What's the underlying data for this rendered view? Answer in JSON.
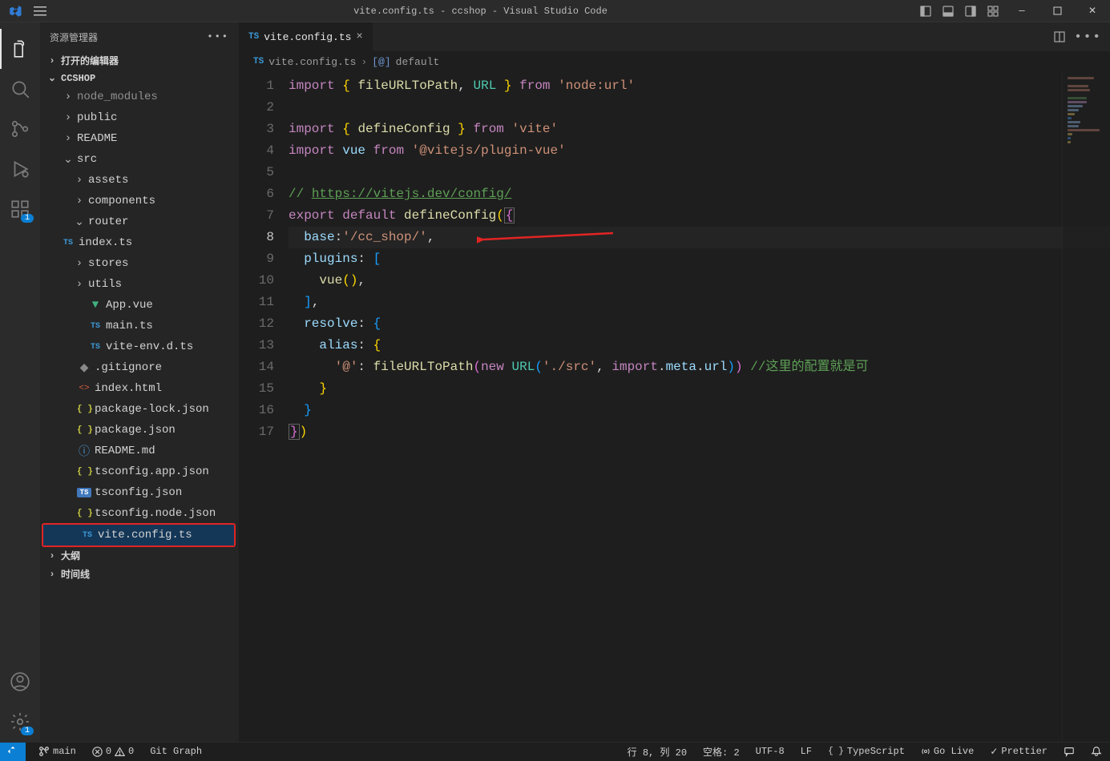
{
  "titlebar": {
    "title": "vite.config.ts - ccshop - Visual Studio Code"
  },
  "activitybar": {
    "ext_badge": "1",
    "settings_badge": "1"
  },
  "sidebar": {
    "header": "资源管理器",
    "sections": {
      "open_editors": "打开的编辑器",
      "project": "CCSHOP",
      "outline": "大纲",
      "timeline": "时间线"
    },
    "files": [
      {
        "name": "node_modules",
        "type": "folder",
        "depth": 1,
        "expanded": false,
        "dim": true
      },
      {
        "name": "public",
        "type": "folder",
        "depth": 1,
        "expanded": false
      },
      {
        "name": "README",
        "type": "folder",
        "depth": 1,
        "expanded": false
      },
      {
        "name": "src",
        "type": "folder",
        "depth": 1,
        "expanded": true
      },
      {
        "name": "assets",
        "type": "folder",
        "depth": 2,
        "expanded": false
      },
      {
        "name": "components",
        "type": "folder",
        "depth": 2,
        "expanded": false
      },
      {
        "name": "router",
        "type": "folder",
        "depth": 2,
        "expanded": true
      },
      {
        "name": "index.ts",
        "type": "ts",
        "depth": 3
      },
      {
        "name": "stores",
        "type": "folder",
        "depth": 2,
        "expanded": false
      },
      {
        "name": "utils",
        "type": "folder",
        "depth": 2,
        "expanded": false
      },
      {
        "name": "App.vue",
        "type": "vue",
        "depth": 2
      },
      {
        "name": "main.ts",
        "type": "ts",
        "depth": 2
      },
      {
        "name": "vite-env.d.ts",
        "type": "ts",
        "depth": 2
      },
      {
        "name": ".gitignore",
        "type": "git",
        "depth": 1
      },
      {
        "name": "index.html",
        "type": "html",
        "depth": 1
      },
      {
        "name": "package-lock.json",
        "type": "json",
        "depth": 1
      },
      {
        "name": "package.json",
        "type": "json",
        "depth": 1
      },
      {
        "name": "README.md",
        "type": "md",
        "depth": 1
      },
      {
        "name": "tsconfig.app.json",
        "type": "json",
        "depth": 1
      },
      {
        "name": "tsconfig.json",
        "type": "tsconfig",
        "depth": 1
      },
      {
        "name": "tsconfig.node.json",
        "type": "json",
        "depth": 1
      },
      {
        "name": "vite.config.ts",
        "type": "ts",
        "depth": 1,
        "selected": true,
        "highlighted": true
      }
    ]
  },
  "tab": {
    "file": "vite.config.ts"
  },
  "breadcrumb": {
    "file": "vite.config.ts",
    "symbol": "default"
  },
  "editor": {
    "lines": 17,
    "current_line": 8,
    "tokens": {
      "l1": {
        "kw1": "import",
        "pun1": "{",
        "fn": "fileURLToPath",
        "pun2": ",",
        "type": "URL",
        "pun3": "}",
        "kw2": "from",
        "str": "'node:url'"
      },
      "l3": {
        "kw1": "import",
        "pun1": "{",
        "fn": "defineConfig",
        "pun2": "}",
        "kw2": "from",
        "str": "'vite'"
      },
      "l4": {
        "kw1": "import",
        "var": "vue",
        "kw2": "from",
        "str": "'@vitejs/plugin-vue'"
      },
      "l6": {
        "cmt": "// ",
        "link": "https://vitejs.dev/config/"
      },
      "l7": {
        "kw1": "export",
        "kw2": "default",
        "fn": "defineConfig",
        "open": "(",
        "brace": "{"
      },
      "l8": {
        "prop": "base",
        "col": ":",
        "str": "'/cc_shop/'",
        "com": ","
      },
      "l9": {
        "prop": "plugins",
        "col": ":",
        "sp": " ",
        "br": "["
      },
      "l10": {
        "fn": "vue",
        "open": "(",
        "close": ")",
        "com": ","
      },
      "l11": {
        "br": "]",
        "com": ","
      },
      "l12": {
        "prop": "resolve",
        "col": ":",
        "sp": " ",
        "brace": "{"
      },
      "l13": {
        "prop": "alias",
        "col": ":",
        "sp": " ",
        "brace": "{"
      },
      "l14": {
        "str1": "'@'",
        "col": ":",
        "sp": " ",
        "fn": "fileURLToPath",
        "open": "(",
        "kw": "new",
        "sp2": " ",
        "type": "URL",
        "open2": "(",
        "str2": "'./src'",
        "com": ",",
        "sp3": " ",
        "kw2": "import",
        "dot": ".",
        "prop1": "meta",
        "dot2": ".",
        "prop2": "url",
        "close2": ")",
        "close": ")",
        "sp4": " ",
        "cmt": "//这里的配置就是可"
      },
      "l15": {
        "brace": "}"
      },
      "l16": {
        "brace": "}"
      },
      "l17": {
        "brace": "}",
        "close": ")"
      }
    }
  },
  "statusbar": {
    "branch": "main",
    "errors": "0",
    "warnings": "0",
    "gitgraph": "Git Graph",
    "cursor": "行 8, 列 20",
    "spaces": "空格: 2",
    "encoding": "UTF-8",
    "eol": "LF",
    "lang": "TypeScript",
    "golive": "Go Live",
    "prettier": "Prettier"
  }
}
